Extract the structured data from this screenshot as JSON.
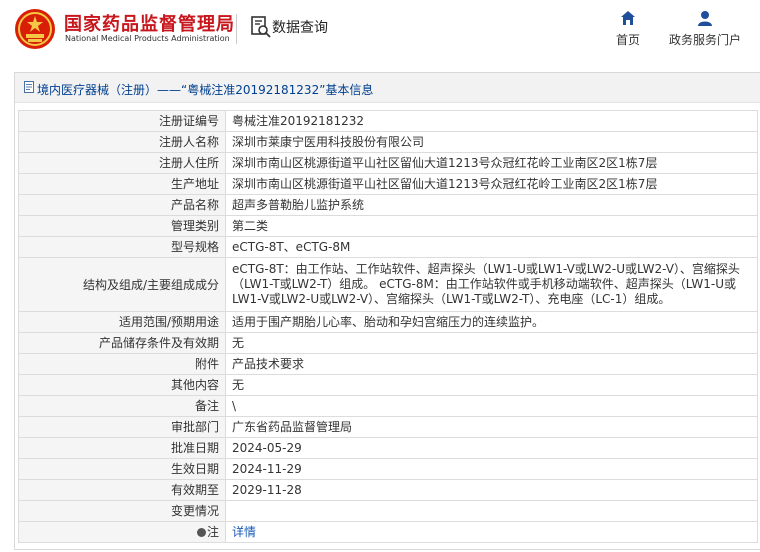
{
  "header": {
    "brand_cn": "国家药品监督管理局",
    "brand_en": "National Medical Products Administration",
    "query_label": "数据查询",
    "nav": [
      {
        "label": "首页",
        "icon": "home-icon"
      },
      {
        "label": "政务服务门户",
        "icon": "user-icon"
      }
    ]
  },
  "title": {
    "text": "境内医疗器械（注册）——“粤械注准20192181232”基本信息"
  },
  "rows": [
    {
      "label": "注册证编号",
      "value": "粤械注准20192181232"
    },
    {
      "label": "注册人名称",
      "value": "深圳市莱康宁医用科技股份有限公司"
    },
    {
      "label": "注册人住所",
      "value": "深圳市南山区桃源街道平山社区留仙大道1213号众冠红花岭工业南区2区1栋7层"
    },
    {
      "label": "生产地址",
      "value": "深圳市南山区桃源街道平山社区留仙大道1213号众冠红花岭工业南区2区1栋7层"
    },
    {
      "label": "产品名称",
      "value": "超声多普勒胎儿监护系统"
    },
    {
      "label": "管理类别",
      "value": "第二类"
    },
    {
      "label": "型号规格",
      "value": "eCTG-8T、eCTG-8M"
    },
    {
      "label": "结构及组成/主要组成成分",
      "value": "eCTG-8T：由工作站、工作站软件、超声探头（LW1-U或LW1-V或LW2-U或LW2-V）、宫缩探头（LW1-T或LW2-T）组成。 eCTG-8M：由工作站软件或手机移动端软件、超声探头（LW1-U或LW1-V或LW2-U或LW2-V）、宫缩探头（LW1-T或LW2-T）、充电座（LC-1）组成。"
    },
    {
      "label": "适用范围/预期用途",
      "value": "适用于围产期胎儿心率、胎动和孕妇宫缩压力的连续监护。"
    },
    {
      "label": "产品储存条件及有效期",
      "value": "无"
    },
    {
      "label": "附件",
      "value": "产品技术要求"
    },
    {
      "label": "其他内容",
      "value": "无"
    },
    {
      "label": "备注",
      "value": "\\"
    },
    {
      "label": "审批部门",
      "value": "广东省药品监督管理局"
    },
    {
      "label": "批准日期",
      "value": "2024-05-29"
    },
    {
      "label": "生效日期",
      "value": "2024-11-29"
    },
    {
      "label": "有效期至",
      "value": "2029-11-28"
    },
    {
      "label": "变更情况",
      "value": ""
    }
  ],
  "note_row": {
    "label": "注",
    "link": "详情"
  },
  "colors": {
    "brand_red": "#c8161d",
    "title_blue": "#003f8f",
    "link_blue": "#1a5bb5",
    "label_bg": "#f5f5f5"
  }
}
